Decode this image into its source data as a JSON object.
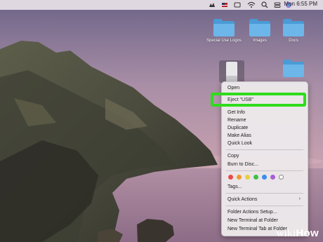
{
  "menubar": {
    "clock": "Mon 6:55 PM",
    "icons": [
      "app-icon",
      "flag-icon",
      "keyboard-icon",
      "wifi-icon",
      "search-icon",
      "control-center-icon",
      "siri-icon"
    ]
  },
  "desktop": {
    "folders": [
      {
        "label": "Special Use Logos"
      },
      {
        "label": "Images"
      },
      {
        "label": "Docs"
      }
    ]
  },
  "context_menu": {
    "items": {
      "open": "Open",
      "eject": "Eject \"USB\"",
      "get_info": "Get Info",
      "rename": "Rename",
      "duplicate": "Duplicate",
      "make_alias": "Make Alias",
      "quick_look": "Quick Look",
      "copy": "Copy",
      "burn": "Burn to Disc...",
      "tags": "Tags...",
      "quick_actions": "Quick Actions",
      "folder_actions": "Folder Actions Setup...",
      "new_terminal": "New Terminal at Folder",
      "new_terminal_tab": "New Terminal Tab at Folder"
    },
    "tag_colors": [
      "#e84a4a",
      "#f09a2c",
      "#e8d03a",
      "#3fbf4a",
      "#3a8df0",
      "#a65fd6",
      "#ffffff"
    ]
  },
  "watermark": {
    "brand_a": "wiki",
    "brand_b": "How"
  }
}
